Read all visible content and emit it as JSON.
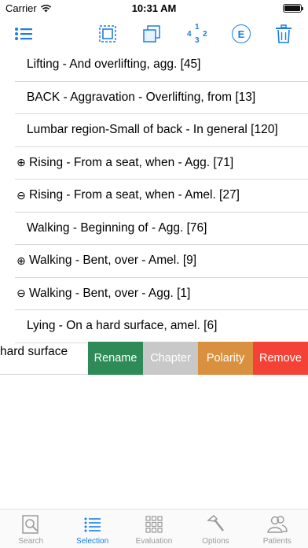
{
  "status_bar": {
    "carrier": "Carrier",
    "time": "10:31 AM"
  },
  "toolbar": {
    "icons": [
      "list-icon",
      "select-frame-icon",
      "copy-icon",
      "numbering-icon",
      "evaluation-e-icon",
      "trash-icon"
    ],
    "numbering_digits": [
      "1",
      "2",
      "3",
      "4"
    ],
    "e_label": "E"
  },
  "rubrics": [
    {
      "polarity": "",
      "text": "Lifting - And overlifting, agg. [45]"
    },
    {
      "polarity": "",
      "text": "BACK - Aggravation - Overlifting, from [13]"
    },
    {
      "polarity": "",
      "text": "Lumbar region-Small of back - In general [120]"
    },
    {
      "polarity": "⊕",
      "text": "Rising - From a seat, when - Agg. [71]"
    },
    {
      "polarity": "⊖",
      "text": "Rising - From a seat, when - Amel. [27]"
    },
    {
      "polarity": "",
      "text": "Walking - Beginning of - Agg. [76]"
    },
    {
      "polarity": "⊕",
      "text": "Walking - Bent, over - Amel. [9]"
    },
    {
      "polarity": "⊖",
      "text": "Walking - Bent, over - Agg. [1]"
    },
    {
      "polarity": "",
      "text": "Lying - On a hard surface, amel. [6]"
    }
  ],
  "swiped_row": {
    "visible_text": "hard surface",
    "actions": [
      {
        "label": "Rename",
        "color": "#2e8b57"
      },
      {
        "label": "Chapter",
        "color": "#c8c8c8"
      },
      {
        "label": "Polarity",
        "color": "#d9913f"
      },
      {
        "label": "Remove",
        "color": "#f44336"
      }
    ]
  },
  "tabbar": {
    "tabs": [
      {
        "label": "Search",
        "icon": "search-book-icon",
        "active": false
      },
      {
        "label": "Selection",
        "icon": "list-icon",
        "active": true
      },
      {
        "label": "Evaluation",
        "icon": "grid-icon",
        "active": false
      },
      {
        "label": "Options",
        "icon": "hammer-icon",
        "active": false
      },
      {
        "label": "Patients",
        "icon": "people-icon",
        "active": false
      }
    ]
  },
  "accent_color": "#1a7de8"
}
